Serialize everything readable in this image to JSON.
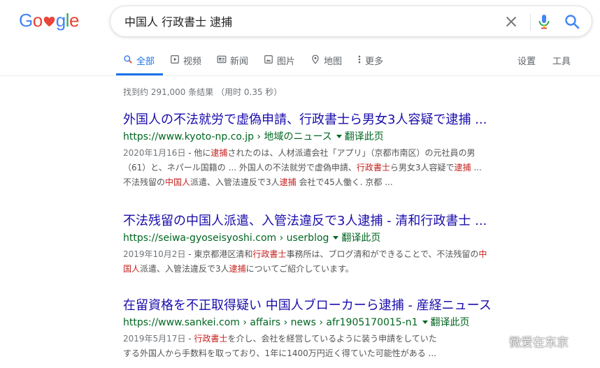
{
  "logo": {
    "letters": [
      "G",
      "o",
      "o",
      "g",
      "l",
      "e"
    ]
  },
  "search": {
    "query": "中国人 行政書士 逮捕"
  },
  "tabs": [
    {
      "label": "全部",
      "icon": "search-icon"
    },
    {
      "label": "视频",
      "icon": "video-icon"
    },
    {
      "label": "新闻",
      "icon": "news-icon"
    },
    {
      "label": "图片",
      "icon": "image-icon"
    },
    {
      "label": "地图",
      "icon": "map-pin-icon"
    },
    {
      "label": "更多",
      "icon": "more-dots-icon"
    }
  ],
  "tools": {
    "settings": "设置",
    "tools": "工具"
  },
  "stats": "找到约 291,000 条结果 （用时 0.35 秒）",
  "results": [
    {
      "title": "外国人の不法就労で虚偽申請、行政書士ら男女3人容疑で逮捕 ...",
      "url": "https://www.kyoto-np.co.jp › 地域のニュース",
      "translate": "翻译此页",
      "date": "2020年1月16日",
      "snippet": [
        [
          " - 他に",
          "逮捕",
          "されたのは、人材派遣会社「アプリ」（京都市南区）の元社員の男"
        ],
        [
          "（61）と、ネパール国籍の ... 外国人の不法就労で虚偽申請、",
          "行政書士",
          "ら男女3人容疑で",
          "逮捕",
          " ..."
        ],
        [
          "不法残留の",
          "中国人",
          "派遣、入管法違反で3人",
          "逮捕",
          " 会社で45人働く. 京都 ..."
        ]
      ]
    },
    {
      "title": "不法残留の中国人派遣、入管法違反で3人逮捕 - 清和行政書士 ...",
      "url": "https://seiwa-gyoseisyoshi.com › userblog",
      "translate": "翻译此页",
      "date": "2019年10月2日",
      "snippet": [
        [
          " - 東京都港区清和",
          "行政書士",
          "事務所は、ブログ清和ができることで、不法残留の",
          "中"
        ],
        [
          "国人",
          "派遣、入管法違反で3人",
          "逮捕",
          "についてご紹介しています。"
        ]
      ]
    },
    {
      "title": "在留資格を不正取得疑い 中国人ブローカーら逮捕 - 産経ニュース",
      "url": "https://www.sankei.com › affairs › news › afr1905170015-n1",
      "translate": "翻译此页",
      "date": "2019年5月17日",
      "snippet": [
        [
          " - ",
          "行政書士",
          "を介し、会社を経営しているように装う申請をしていた"
        ],
        [
          "する外国人から手数料を取っており、1年に1400万円近く得ていた可能性がある ..."
        ]
      ]
    }
  ],
  "watermark": "微爱在东京",
  "colors": {
    "link": "#1a0dab",
    "url": "#006621",
    "accent": "#1a73e8",
    "highlight": "#c5221f"
  }
}
